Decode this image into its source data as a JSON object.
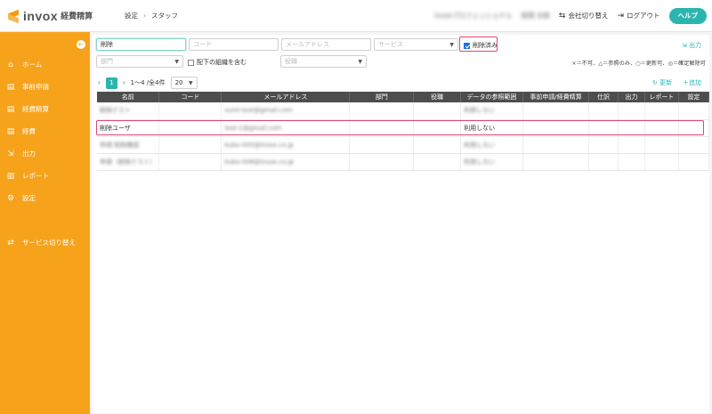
{
  "header": {
    "logo_text": "invox",
    "logo_sub": "経費精算",
    "breadcrumb": [
      "設定",
      "スタッフ"
    ],
    "company_name": "invoxプロフェッショナル",
    "user_name": "経理 太郎",
    "switch_company": "会社切り替え",
    "logout": "ログアウト",
    "help": "ヘルプ"
  },
  "sidebar": {
    "items": [
      {
        "label": "ホーム",
        "icon": "home-icon"
      },
      {
        "label": "事前申請",
        "icon": "document-icon"
      },
      {
        "label": "経費精算",
        "icon": "document-icon"
      },
      {
        "label": "経費",
        "icon": "document-icon"
      },
      {
        "label": "出力",
        "icon": "export-icon"
      },
      {
        "label": "レポート",
        "icon": "chart-icon"
      },
      {
        "label": "設定",
        "icon": "gear-icon"
      },
      {
        "label": "サービス切り替え",
        "icon": "switch-icon"
      }
    ]
  },
  "filters": {
    "name_value": "削除",
    "code_placeholder": "コード",
    "email_placeholder": "メールアドレス",
    "service_placeholder": "サービス",
    "deleted_label": "削除済み",
    "department_placeholder": "部門",
    "include_sub_label": "配下の組織を含む",
    "position_placeholder": "役職",
    "output_label": "出力",
    "legend": "×＝不可、△＝参照のみ、○＝更新可、◎＝確定解除可",
    "refresh_label": "更新",
    "add_label": "追加"
  },
  "pager": {
    "current_page": "1",
    "range_text": "1〜4 /全4件",
    "per_page": "20"
  },
  "table": {
    "columns": [
      "名前",
      "コード",
      "メールアドレス",
      "部門",
      "役職",
      "データの参照範囲",
      "事前申請/経費精算",
      "仕訳",
      "出力",
      "レポート",
      "設定"
    ],
    "rows": [
      {
        "name": "削除テスト",
        "code": "",
        "email": "sumi-test@gmail.com",
        "dept": "",
        "pos": "",
        "scope": "利用しない"
      },
      {
        "name": "削除ユーザ",
        "code": "",
        "email": "test-1@gmail.com",
        "dept": "",
        "pos": "",
        "scope": "利用しない"
      },
      {
        "name": "申請 削除確認",
        "code": "",
        "email": "kubo-005@invox.co.jp",
        "dept": "",
        "pos": "",
        "scope": "利用しない"
      },
      {
        "name": "申請（削除テスト）",
        "code": "",
        "email": "kubo-006@invox.co.jp",
        "dept": "",
        "pos": "",
        "scope": "利用しない"
      }
    ]
  }
}
